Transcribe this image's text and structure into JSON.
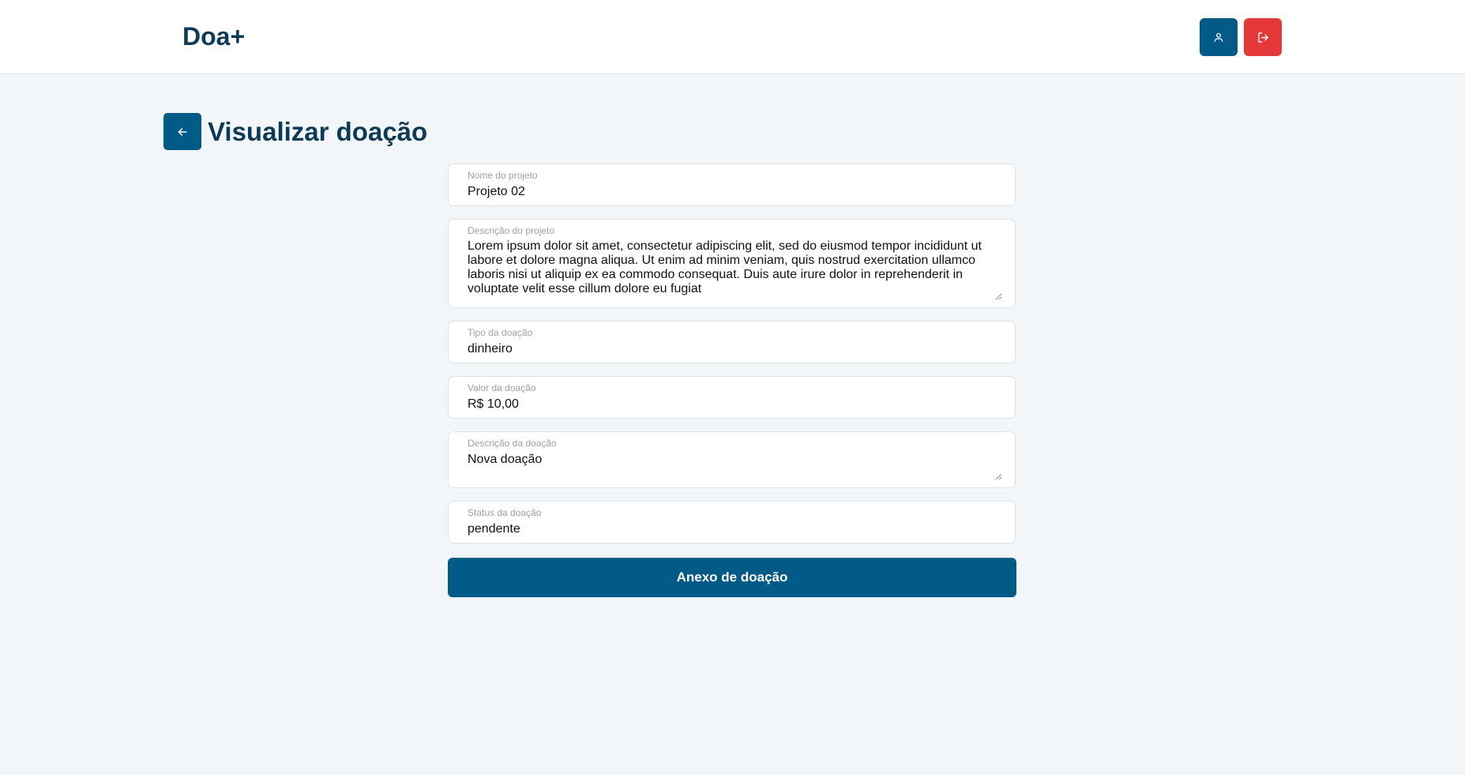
{
  "header": {
    "brand": "Doa+",
    "profile_icon": "user-icon",
    "logout_icon": "logout-icon"
  },
  "page": {
    "title": "Visualizar doação",
    "back_icon": "arrow-left-icon"
  },
  "form": {
    "project_name": {
      "label": "Nome do projeto",
      "value": "Projeto 02"
    },
    "project_description": {
      "label": "Descrição do projeto",
      "value": "Lorem ipsum dolor sit amet, consectetur adipiscing elit, sed do eiusmod tempor incididunt ut labore et dolore magna aliqua. Ut enim ad minim veniam, quis nostrud exercitation ullamco laboris nisi ut aliquip ex ea commodo consequat. Duis aute irure dolor in reprehenderit in voluptate velit esse cillum dolore eu fugiat"
    },
    "donation_type": {
      "label": "Tipo da doação",
      "value": "dinheiro"
    },
    "donation_value": {
      "label": "Valor da doação",
      "value": "R$ 10,00"
    },
    "donation_description": {
      "label": "Descrição da doação",
      "value": "Nova doação"
    },
    "donation_status": {
      "label": "Status da doação",
      "value": "pendente"
    },
    "attachment_button": "Anexo de doação"
  },
  "colors": {
    "primary": "#025a87",
    "danger": "#e5383b",
    "heading": "#0d3a55",
    "background": "#f3f6f9"
  }
}
